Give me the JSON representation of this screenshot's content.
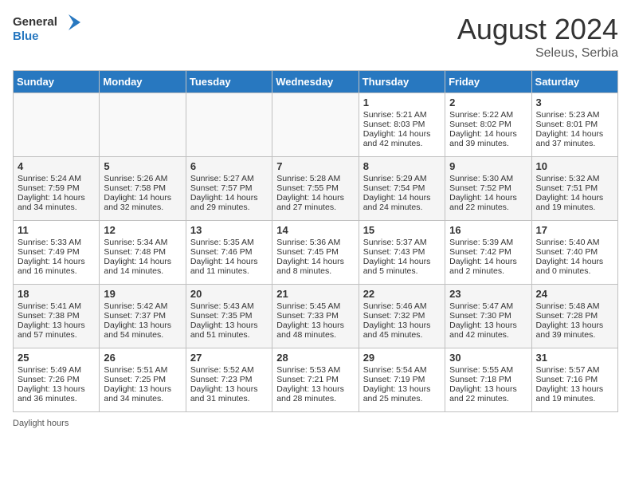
{
  "header": {
    "logo_general": "General",
    "logo_blue": "Blue",
    "month_year": "August 2024",
    "location": "Seleus, Serbia"
  },
  "days_of_week": [
    "Sunday",
    "Monday",
    "Tuesday",
    "Wednesday",
    "Thursday",
    "Friday",
    "Saturday"
  ],
  "weeks": [
    [
      {
        "day": "",
        "content": ""
      },
      {
        "day": "",
        "content": ""
      },
      {
        "day": "",
        "content": ""
      },
      {
        "day": "",
        "content": ""
      },
      {
        "day": "1",
        "content": "Sunrise: 5:21 AM\nSunset: 8:03 PM\nDaylight: 14 hours and 42 minutes."
      },
      {
        "day": "2",
        "content": "Sunrise: 5:22 AM\nSunset: 8:02 PM\nDaylight: 14 hours and 39 minutes."
      },
      {
        "day": "3",
        "content": "Sunrise: 5:23 AM\nSunset: 8:01 PM\nDaylight: 14 hours and 37 minutes."
      }
    ],
    [
      {
        "day": "4",
        "content": "Sunrise: 5:24 AM\nSunset: 7:59 PM\nDaylight: 14 hours and 34 minutes."
      },
      {
        "day": "5",
        "content": "Sunrise: 5:26 AM\nSunset: 7:58 PM\nDaylight: 14 hours and 32 minutes."
      },
      {
        "day": "6",
        "content": "Sunrise: 5:27 AM\nSunset: 7:57 PM\nDaylight: 14 hours and 29 minutes."
      },
      {
        "day": "7",
        "content": "Sunrise: 5:28 AM\nSunset: 7:55 PM\nDaylight: 14 hours and 27 minutes."
      },
      {
        "day": "8",
        "content": "Sunrise: 5:29 AM\nSunset: 7:54 PM\nDaylight: 14 hours and 24 minutes."
      },
      {
        "day": "9",
        "content": "Sunrise: 5:30 AM\nSunset: 7:52 PM\nDaylight: 14 hours and 22 minutes."
      },
      {
        "day": "10",
        "content": "Sunrise: 5:32 AM\nSunset: 7:51 PM\nDaylight: 14 hours and 19 minutes."
      }
    ],
    [
      {
        "day": "11",
        "content": "Sunrise: 5:33 AM\nSunset: 7:49 PM\nDaylight: 14 hours and 16 minutes."
      },
      {
        "day": "12",
        "content": "Sunrise: 5:34 AM\nSunset: 7:48 PM\nDaylight: 14 hours and 14 minutes."
      },
      {
        "day": "13",
        "content": "Sunrise: 5:35 AM\nSunset: 7:46 PM\nDaylight: 14 hours and 11 minutes."
      },
      {
        "day": "14",
        "content": "Sunrise: 5:36 AM\nSunset: 7:45 PM\nDaylight: 14 hours and 8 minutes."
      },
      {
        "day": "15",
        "content": "Sunrise: 5:37 AM\nSunset: 7:43 PM\nDaylight: 14 hours and 5 minutes."
      },
      {
        "day": "16",
        "content": "Sunrise: 5:39 AM\nSunset: 7:42 PM\nDaylight: 14 hours and 2 minutes."
      },
      {
        "day": "17",
        "content": "Sunrise: 5:40 AM\nSunset: 7:40 PM\nDaylight: 14 hours and 0 minutes."
      }
    ],
    [
      {
        "day": "18",
        "content": "Sunrise: 5:41 AM\nSunset: 7:38 PM\nDaylight: 13 hours and 57 minutes."
      },
      {
        "day": "19",
        "content": "Sunrise: 5:42 AM\nSunset: 7:37 PM\nDaylight: 13 hours and 54 minutes."
      },
      {
        "day": "20",
        "content": "Sunrise: 5:43 AM\nSunset: 7:35 PM\nDaylight: 13 hours and 51 minutes."
      },
      {
        "day": "21",
        "content": "Sunrise: 5:45 AM\nSunset: 7:33 PM\nDaylight: 13 hours and 48 minutes."
      },
      {
        "day": "22",
        "content": "Sunrise: 5:46 AM\nSunset: 7:32 PM\nDaylight: 13 hours and 45 minutes."
      },
      {
        "day": "23",
        "content": "Sunrise: 5:47 AM\nSunset: 7:30 PM\nDaylight: 13 hours and 42 minutes."
      },
      {
        "day": "24",
        "content": "Sunrise: 5:48 AM\nSunset: 7:28 PM\nDaylight: 13 hours and 39 minutes."
      }
    ],
    [
      {
        "day": "25",
        "content": "Sunrise: 5:49 AM\nSunset: 7:26 PM\nDaylight: 13 hours and 36 minutes."
      },
      {
        "day": "26",
        "content": "Sunrise: 5:51 AM\nSunset: 7:25 PM\nDaylight: 13 hours and 34 minutes."
      },
      {
        "day": "27",
        "content": "Sunrise: 5:52 AM\nSunset: 7:23 PM\nDaylight: 13 hours and 31 minutes."
      },
      {
        "day": "28",
        "content": "Sunrise: 5:53 AM\nSunset: 7:21 PM\nDaylight: 13 hours and 28 minutes."
      },
      {
        "day": "29",
        "content": "Sunrise: 5:54 AM\nSunset: 7:19 PM\nDaylight: 13 hours and 25 minutes."
      },
      {
        "day": "30",
        "content": "Sunrise: 5:55 AM\nSunset: 7:18 PM\nDaylight: 13 hours and 22 minutes."
      },
      {
        "day": "31",
        "content": "Sunrise: 5:57 AM\nSunset: 7:16 PM\nDaylight: 13 hours and 19 minutes."
      }
    ]
  ],
  "footer": {
    "daylight_label": "Daylight hours"
  }
}
